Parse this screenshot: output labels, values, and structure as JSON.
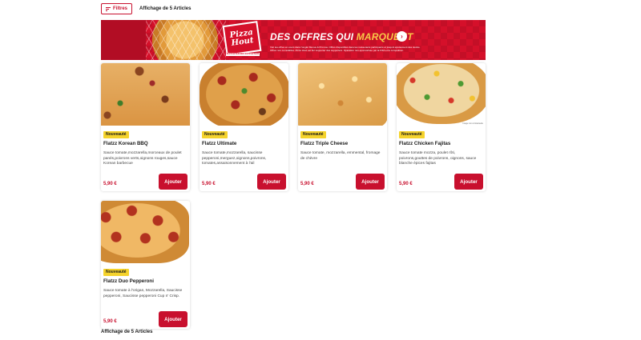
{
  "toolbar": {
    "filter_label": "Filtres",
    "count_text": "Affichage de 5 Articles"
  },
  "banner": {
    "logo_line1": "Pizza",
    "logo_line2": "Hout",
    "logo_tag": "SUPPORTER DES SUPPORTERS",
    "headline_part1": "DES OFFRES QUI",
    "headline_accent": "MARQUENT",
    "arrow": "›",
    "legal": "Voir les offres en cours dans l'onglet Menus & Promos. Offres disponibles dans les restaurants participants et jusqu'à épuisement des stocks. Offres non cumulables. Pizza Hout est fier supporter des supporters. Opération non-sponsorisée par la FIFA et la compétition."
  },
  "products": [
    {
      "badge": "Nouveauté",
      "title": "Flatzz Korean BBQ",
      "description": "Sauce tomate,mozzarella,morceaux de poulet panés,poivrons verts,oignons rouges,sauce Korean barbecue",
      "price": "5,90 €",
      "add_label": "Ajouter",
      "image_caption": ""
    },
    {
      "badge": "Nouveauté",
      "title": "Flatzz Ultimate",
      "description": "Sauce tomate,mozzarella, saucisse pepperoni,merguez,oignons,poivrons, tomates,assaisonnement à l'ail",
      "price": "5,90 €",
      "add_label": "Ajouter",
      "image_caption": ""
    },
    {
      "badge": "Nouveauté",
      "title": "Flatzz Triple Cheese",
      "description": "Sauce tomate, mozzarella, emmental, fromage de chèvre",
      "price": "5,90 €",
      "add_label": "Ajouter",
      "image_caption": ""
    },
    {
      "badge": "Nouveauté",
      "title": "Flatzz Chicken Fajitas",
      "description": "Sauce tomate mozza, poulet rôti, poivrons,gouttes de poivrons, oignons, sauce blanche épices fajitas",
      "price": "5,90 €",
      "add_label": "Ajouter",
      "image_caption": "Image non contractuelle"
    },
    {
      "badge": "Nouveauté",
      "title": "Flatzz Duo Pepperoni",
      "description": "Sauce tomate à l'origan, Mozzarella, Saucisse pepperoni, Saucisse pepperoni Cup n' Crisp.",
      "price": "5,90 €",
      "add_label": "Ajouter",
      "image_caption": ""
    }
  ],
  "footer": {
    "count_text": "Affichage de 5 Articles"
  },
  "colors": {
    "brand_red": "#c8102e",
    "badge_yellow": "#f5d32c"
  }
}
